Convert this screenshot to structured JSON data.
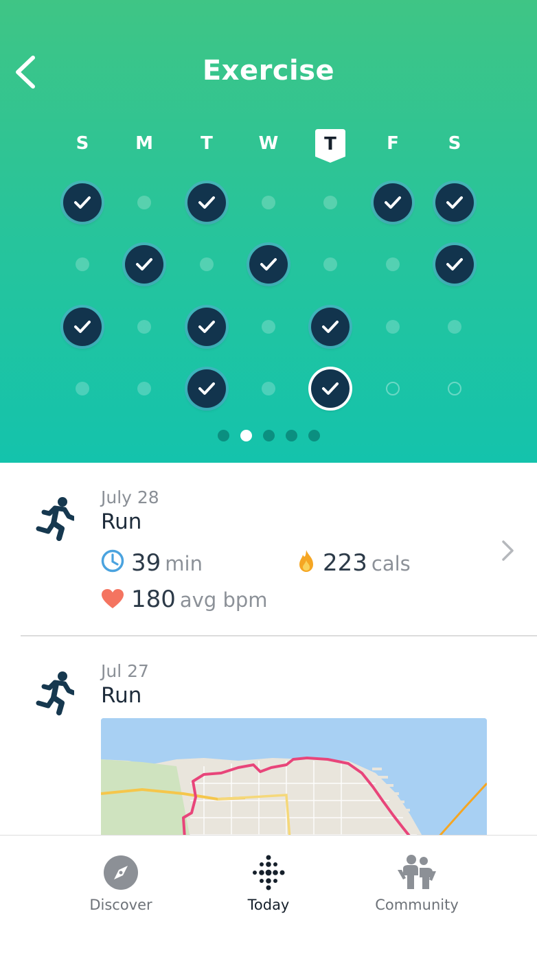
{
  "header": {
    "title": "Exercise",
    "days": [
      "S",
      "M",
      "T",
      "W",
      "T",
      "F",
      "S"
    ],
    "selected_day_index": 4,
    "weeks": [
      [
        "done",
        "none",
        "done",
        "none",
        "none",
        "done",
        "done"
      ],
      [
        "none",
        "done",
        "none",
        "done",
        "none",
        "none",
        "done"
      ],
      [
        "done",
        "none",
        "done",
        "none",
        "done",
        "none",
        "none"
      ],
      [
        "none",
        "none",
        "done",
        "none",
        "today",
        "future",
        "future"
      ]
    ],
    "pages": 5,
    "current_page": 1
  },
  "activities": [
    {
      "date": "July 28",
      "name": "Run",
      "duration_value": "39",
      "duration_unit": "min",
      "cals_value": "223",
      "cals_unit": "cals",
      "bpm_value": "180",
      "bpm_unit": "avg bpm"
    },
    {
      "date": "Jul 27",
      "name": "Run"
    }
  ],
  "nav": {
    "discover": "Discover",
    "today": "Today",
    "community": "Community",
    "active": "today"
  },
  "colors": {
    "header_top": "#3fc585",
    "header_bottom": "#14c3ac",
    "check_fill": "#12344d",
    "route": "#e8457a",
    "heart": "#f47460",
    "clock": "#4aa3df",
    "flame": "#f5a623"
  }
}
